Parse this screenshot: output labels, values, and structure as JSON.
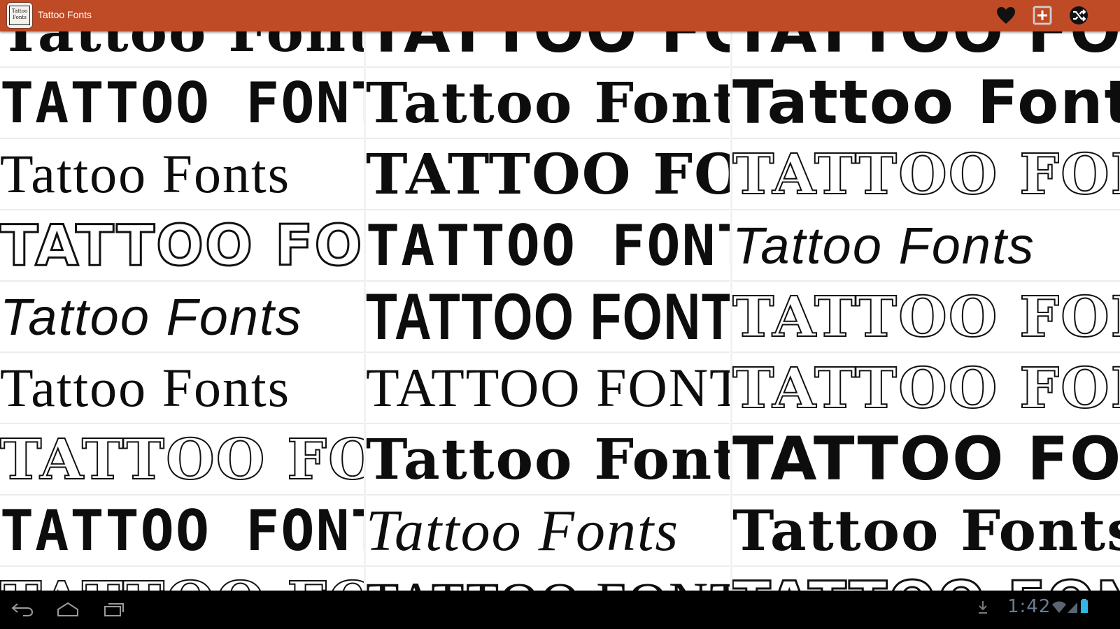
{
  "app": {
    "title": "Tattoo Fonts",
    "icon_text_line1": "Tattoo",
    "icon_text_line2": "Fonts"
  },
  "colors": {
    "action_bar": "#bf4a26",
    "nav_bar": "#000000",
    "clock": "#6a7d93"
  },
  "action_bar": {
    "actions": [
      {
        "name": "favorite",
        "icon": "heart-icon"
      },
      {
        "name": "add",
        "icon": "add-box-icon"
      },
      {
        "name": "shuffle",
        "icon": "shuffle-icon"
      }
    ]
  },
  "gallery": {
    "columns": [
      {
        "tiles": [
          {
            "text": "Tattoo Fonts",
            "style": "f-serif-black"
          },
          {
            "text": "TATTOO FONTS",
            "style": "f-mono"
          },
          {
            "text": "Tattoo Fonts",
            "style": "f-serif"
          },
          {
            "text": "TATTOO FONTS",
            "style": "f-outline"
          },
          {
            "text": "Tattoo Fonts",
            "style": "f-light-ital"
          },
          {
            "text": "Tattoo Fonts",
            "style": "f-serif"
          },
          {
            "text": "TATTOO FONTS",
            "style": "f-outline-thin"
          },
          {
            "text": "TATTOO FONTS",
            "style": "f-mono"
          },
          {
            "text": "TATTOO FONTS",
            "style": "f-outline-thin"
          }
        ]
      },
      {
        "tiles": [
          {
            "text": "TATTOO FONTS",
            "style": "f-sans-black"
          },
          {
            "text": "Tattoo Fonts",
            "style": "f-serif-black"
          },
          {
            "text": "TATTOO FONTS",
            "style": "f-serif-black"
          },
          {
            "text": "TATTOO FONTS",
            "style": "f-mono"
          },
          {
            "text": "TATTOO FONTS",
            "style": "f-cond"
          },
          {
            "text": "TATTOO FONTS",
            "style": "f-serif"
          },
          {
            "text": "Tattoo Fonts",
            "style": "f-serif-black"
          },
          {
            "text": "Tattoo Fonts",
            "style": "f-script"
          },
          {
            "text": "TATTOO FONTS",
            "style": "f-serif"
          }
        ]
      },
      {
        "tiles": [
          {
            "text": "TATTOO FONTS",
            "style": "f-sans-black"
          },
          {
            "text": "Tattoo Fonts",
            "style": "f-sans-black"
          },
          {
            "text": "TATTOO FONTS",
            "style": "f-outline-thin"
          },
          {
            "text": "Tattoo Fonts",
            "style": "f-light-ital"
          },
          {
            "text": "TATTOO FONTS",
            "style": "f-outline-thin"
          },
          {
            "text": "TATTOO FONTS",
            "style": "f-outline-thin"
          },
          {
            "text": "TATTOO FONTS",
            "style": "f-sans-black"
          },
          {
            "text": "Tattoo Fonts",
            "style": "f-serif-black"
          },
          {
            "text": "TATTOO FONTS",
            "style": "f-outline"
          }
        ]
      }
    ]
  },
  "system_bar": {
    "clock": "1:42",
    "nav_buttons": [
      {
        "name": "back",
        "icon": "back-icon"
      },
      {
        "name": "home",
        "icon": "home-icon"
      },
      {
        "name": "recents",
        "icon": "recent-apps-icon"
      }
    ],
    "status_icons": [
      "download-icon",
      "wifi-icon",
      "signal-icon",
      "battery-icon"
    ]
  }
}
